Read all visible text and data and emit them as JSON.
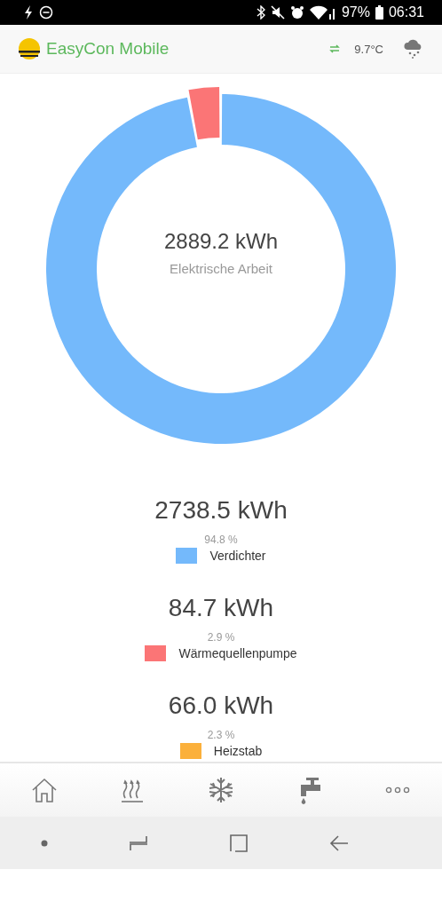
{
  "status_bar": {
    "battery": "97%",
    "time": "06:31"
  },
  "header": {
    "title": "EasyCon Mobile",
    "temperature": "9.7°C"
  },
  "summary": {
    "value": "2889.2 kWh",
    "label": "Elektrische Arbeit",
    "chart_data": {
      "type": "donut",
      "categories": [
        "Verdichter",
        "Wärmequellenpumpe"
      ],
      "values": [
        97.0,
        3.0
      ]
    }
  },
  "legend": [
    {
      "value": "2738.5 kWh",
      "percent": "94.8 %",
      "color": "#74b9fb"
    },
    {
      "value": "84.7 kWh",
      "percent": "2.9 %",
      "color": "#fb7576"
    },
    {
      "value": "66.0 kWh",
      "percent": "2.3 %",
      "name": "Heizstab",
      "color": "#fbb03b"
    }
  ],
  "bottom_nav": [
    {
      "kind": "home"
    },
    {
      "kind": "heating"
    },
    {
      "kind": "cooling"
    },
    {
      "kind": "water"
    },
    {
      "kind": "more"
    }
  ]
}
